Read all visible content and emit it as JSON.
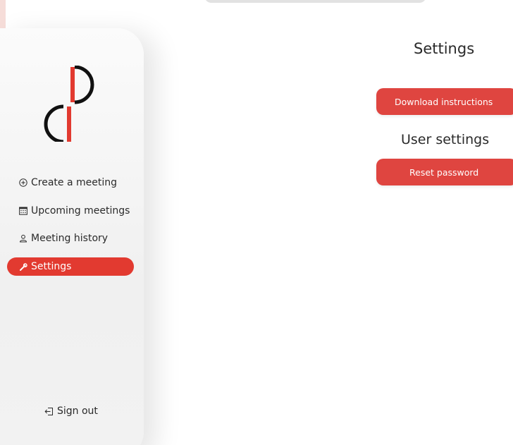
{
  "colors": {
    "accent": "#e23a30",
    "button": "#df4540",
    "sidebar_bg": "#f2f2f2",
    "left_strip": "#f6ddd9"
  },
  "sidebar": {
    "logo": "dp-logo",
    "items": [
      {
        "label": "Create a meeting",
        "icon": "plus-circle-icon",
        "active": false
      },
      {
        "label": "Upcoming meetings",
        "icon": "calendar-icon",
        "active": false
      },
      {
        "label": "Meeting history",
        "icon": "user-icon",
        "active": false
      },
      {
        "label": "Settings",
        "icon": "wrench-icon",
        "active": true
      }
    ],
    "signout": {
      "label": "Sign out",
      "icon": "sign-out-icon"
    }
  },
  "main": {
    "title": "Settings",
    "download_button": "Download instructions",
    "user_settings_title": "User settings",
    "reset_button": "Reset password"
  }
}
